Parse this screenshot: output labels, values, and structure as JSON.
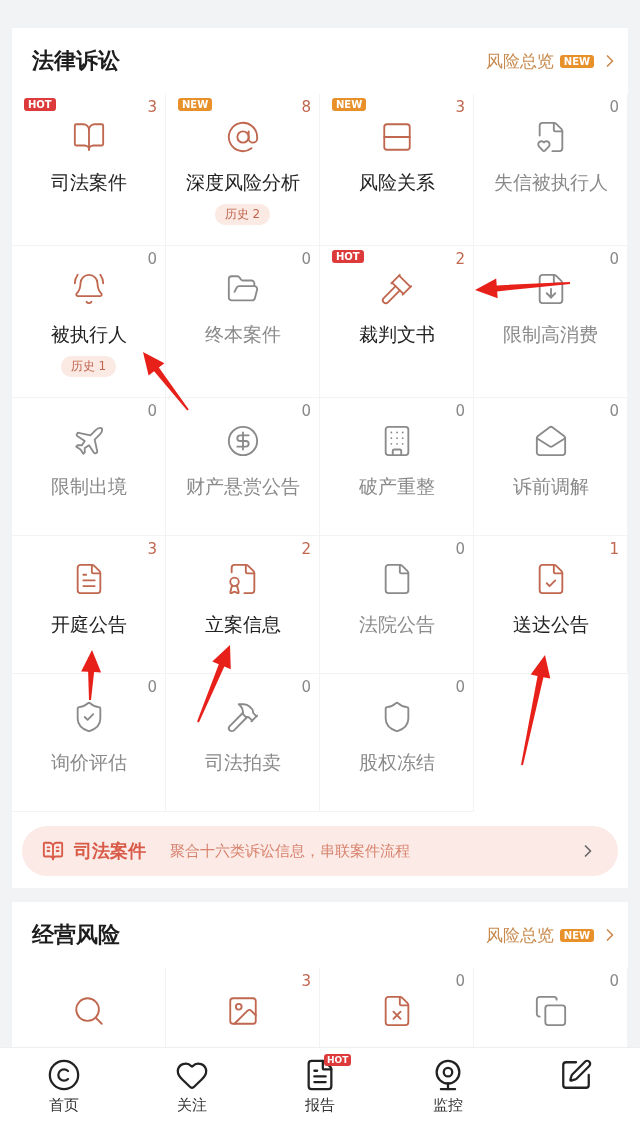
{
  "sections": [
    {
      "title": "法律诉讼",
      "link": {
        "text": "风险总览",
        "badge": "NEW"
      },
      "items": [
        {
          "label": "司法案件",
          "count": "3",
          "active": true,
          "badge": {
            "text": "HOT",
            "kind": "hot"
          }
        },
        {
          "label": "深度风险分析",
          "count": "8",
          "active": true,
          "badge": {
            "text": "NEW",
            "kind": "new"
          },
          "history": "历史 2"
        },
        {
          "label": "风险关系",
          "count": "3",
          "active": true,
          "badge": {
            "text": "NEW",
            "kind": "new"
          }
        },
        {
          "label": "失信被执行人",
          "count": "0",
          "active": false
        },
        {
          "label": "被执行人",
          "count": "0",
          "active": true,
          "history": "历史 1"
        },
        {
          "label": "终本案件",
          "count": "0",
          "active": false
        },
        {
          "label": "裁判文书",
          "count": "2",
          "active": true,
          "badge": {
            "text": "HOT",
            "kind": "hot"
          }
        },
        {
          "label": "限制高消费",
          "count": "0",
          "active": false
        },
        {
          "label": "限制出境",
          "count": "0",
          "active": false
        },
        {
          "label": "财产悬赏公告",
          "count": "0",
          "active": false
        },
        {
          "label": "破产重整",
          "count": "0",
          "active": false
        },
        {
          "label": "诉前调解",
          "count": "0",
          "active": false
        },
        {
          "label": "开庭公告",
          "count": "3",
          "active": true
        },
        {
          "label": "立案信息",
          "count": "2",
          "active": true
        },
        {
          "label": "法院公告",
          "count": "0",
          "active": false
        },
        {
          "label": "送达公告",
          "count": "1",
          "active": true
        },
        {
          "label": "询价评估",
          "count": "0",
          "active": false
        },
        {
          "label": "司法拍卖",
          "count": "0",
          "active": false
        },
        {
          "label": "股权冻结",
          "count": "0",
          "active": false
        }
      ],
      "banner": {
        "title": "司法案件",
        "text": "聚合十六类诉讼信息，串联案件流程"
      }
    },
    {
      "title": "经营风险",
      "link": {
        "text": "风险总览",
        "badge": "NEW"
      },
      "items": [
        {
          "active": true
        },
        {
          "count": "3",
          "active": true
        },
        {
          "count": "0",
          "active": true
        },
        {
          "count": "0",
          "active": false
        }
      ]
    }
  ],
  "tab_bar": [
    {
      "label": "首页"
    },
    {
      "label": "关注"
    },
    {
      "label": "报告",
      "badge": "HOT"
    },
    {
      "label": "监控"
    }
  ]
}
